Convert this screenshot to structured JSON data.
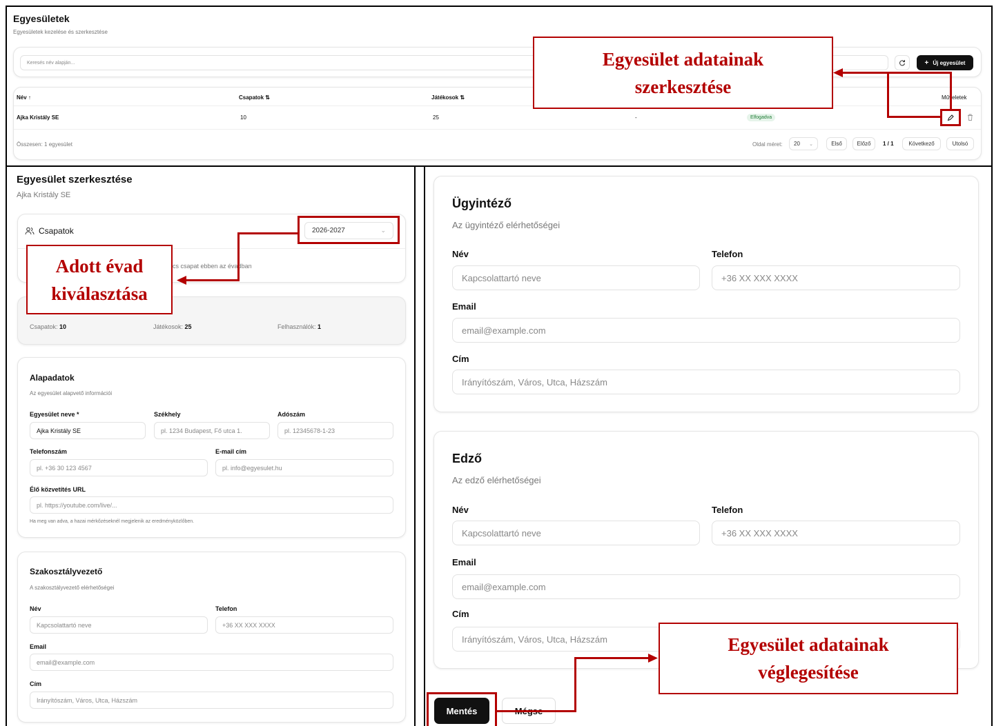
{
  "top": {
    "title": "Egyesületek",
    "subtitle": "Egyesületek kezelése és szerkesztése",
    "search_placeholder": "Keresés név alapján...",
    "new_button": "Új egyesület",
    "columns": {
      "name": "Név",
      "teams": "Csapatok",
      "players": "Játékosok",
      "actions": "Műveletek"
    },
    "row": {
      "name": "Ajka Kristály SE",
      "teams": "10",
      "players": "25",
      "dash": "-",
      "status": "Elfogadva"
    },
    "footer": {
      "total": "Összesen: 1 egyesület",
      "page_size_label": "Oldal méret:",
      "page_size": "20",
      "first": "Első",
      "prev": "Előző",
      "page": "1 / 1",
      "next": "Következő",
      "last": "Utolsó"
    }
  },
  "left": {
    "title": "Egyesület szerkesztése",
    "subtitle": "Ajka Kristály SE",
    "teams_label": "Csapatok",
    "season": "2026-2027",
    "no_teams_text": "cs csapat ebben az évadban",
    "stats": {
      "teams_label": "Csapatok:",
      "teams": "10",
      "players_label": "Játékosok:",
      "players": "25",
      "users_label": "Felhasználók:",
      "users": "1"
    },
    "basic": {
      "title": "Alapadatok",
      "desc": "Az egyesület alapvető információi",
      "name_label": "Egyesület neve *",
      "name_value": "Ajka Kristály SE",
      "seat_label": "Székhely",
      "seat_placeholder": "pl. 1234 Budapest, Fő utca 1.",
      "tax_label": "Adószám",
      "tax_placeholder": "pl. 12345678-1-23",
      "phone_label": "Telefonszám",
      "phone_placeholder": "pl. +36 30 123 4567",
      "email_label": "E-mail cím",
      "email_placeholder": "pl. info@egyesulet.hu",
      "live_label": "Élő közvetítés URL",
      "live_placeholder": "pl. https://youtube.com/live/...",
      "live_hint": "Ha meg van adva, a hazai mérkőzéseknél megjelenik az eredményközlőben."
    },
    "head": {
      "title": "Szakosztályvezető",
      "desc": "A szakosztályvezető elérhetőségei",
      "name_label": "Név",
      "name_placeholder": "Kapcsolattartó neve",
      "phone_label": "Telefon",
      "phone_placeholder": "+36 XX XXX XXXX",
      "email_label": "Email",
      "email_placeholder": "email@example.com",
      "address_label": "Cím",
      "address_placeholder": "Irányítószám, Város, Utca, Házszám"
    }
  },
  "right": {
    "admin": {
      "title": "Ügyintéző",
      "desc": "Az ügyintéző elérhetőségei",
      "name_label": "Név",
      "name_placeholder": "Kapcsolattartó neve",
      "phone_label": "Telefon",
      "phone_placeholder": "+36 XX XXX XXXX",
      "email_label": "Email",
      "email_placeholder": "email@example.com",
      "address_label": "Cím",
      "address_placeholder": "Irányítószám, Város, Utca, Házszám"
    },
    "coach": {
      "title": "Edző",
      "desc": "Az edző elérhetőségei",
      "name_label": "Név",
      "name_placeholder": "Kapcsolattartó neve",
      "phone_label": "Telefon",
      "phone_placeholder": "+36 XX XXX XXXX",
      "email_label": "Email",
      "email_placeholder": "email@example.com",
      "address_label": "Cím",
      "address_placeholder": "Irányítószám, Város, Utca, Házszám"
    },
    "save": "Mentés",
    "cancel": "Mégse"
  },
  "annotations": {
    "edit_line1": "Egyesület adatainak",
    "edit_line2": "szerkesztése",
    "season_line1": "Adott évad",
    "season_line2": "kiválasztása",
    "save_line1": "Egyesület adatainak",
    "save_line2": "véglegesítése"
  },
  "colors": {
    "annotation": "#b30000",
    "badge_bg": "#e6f4ea",
    "badge_text": "#1e7b34",
    "primary": "#111111"
  }
}
